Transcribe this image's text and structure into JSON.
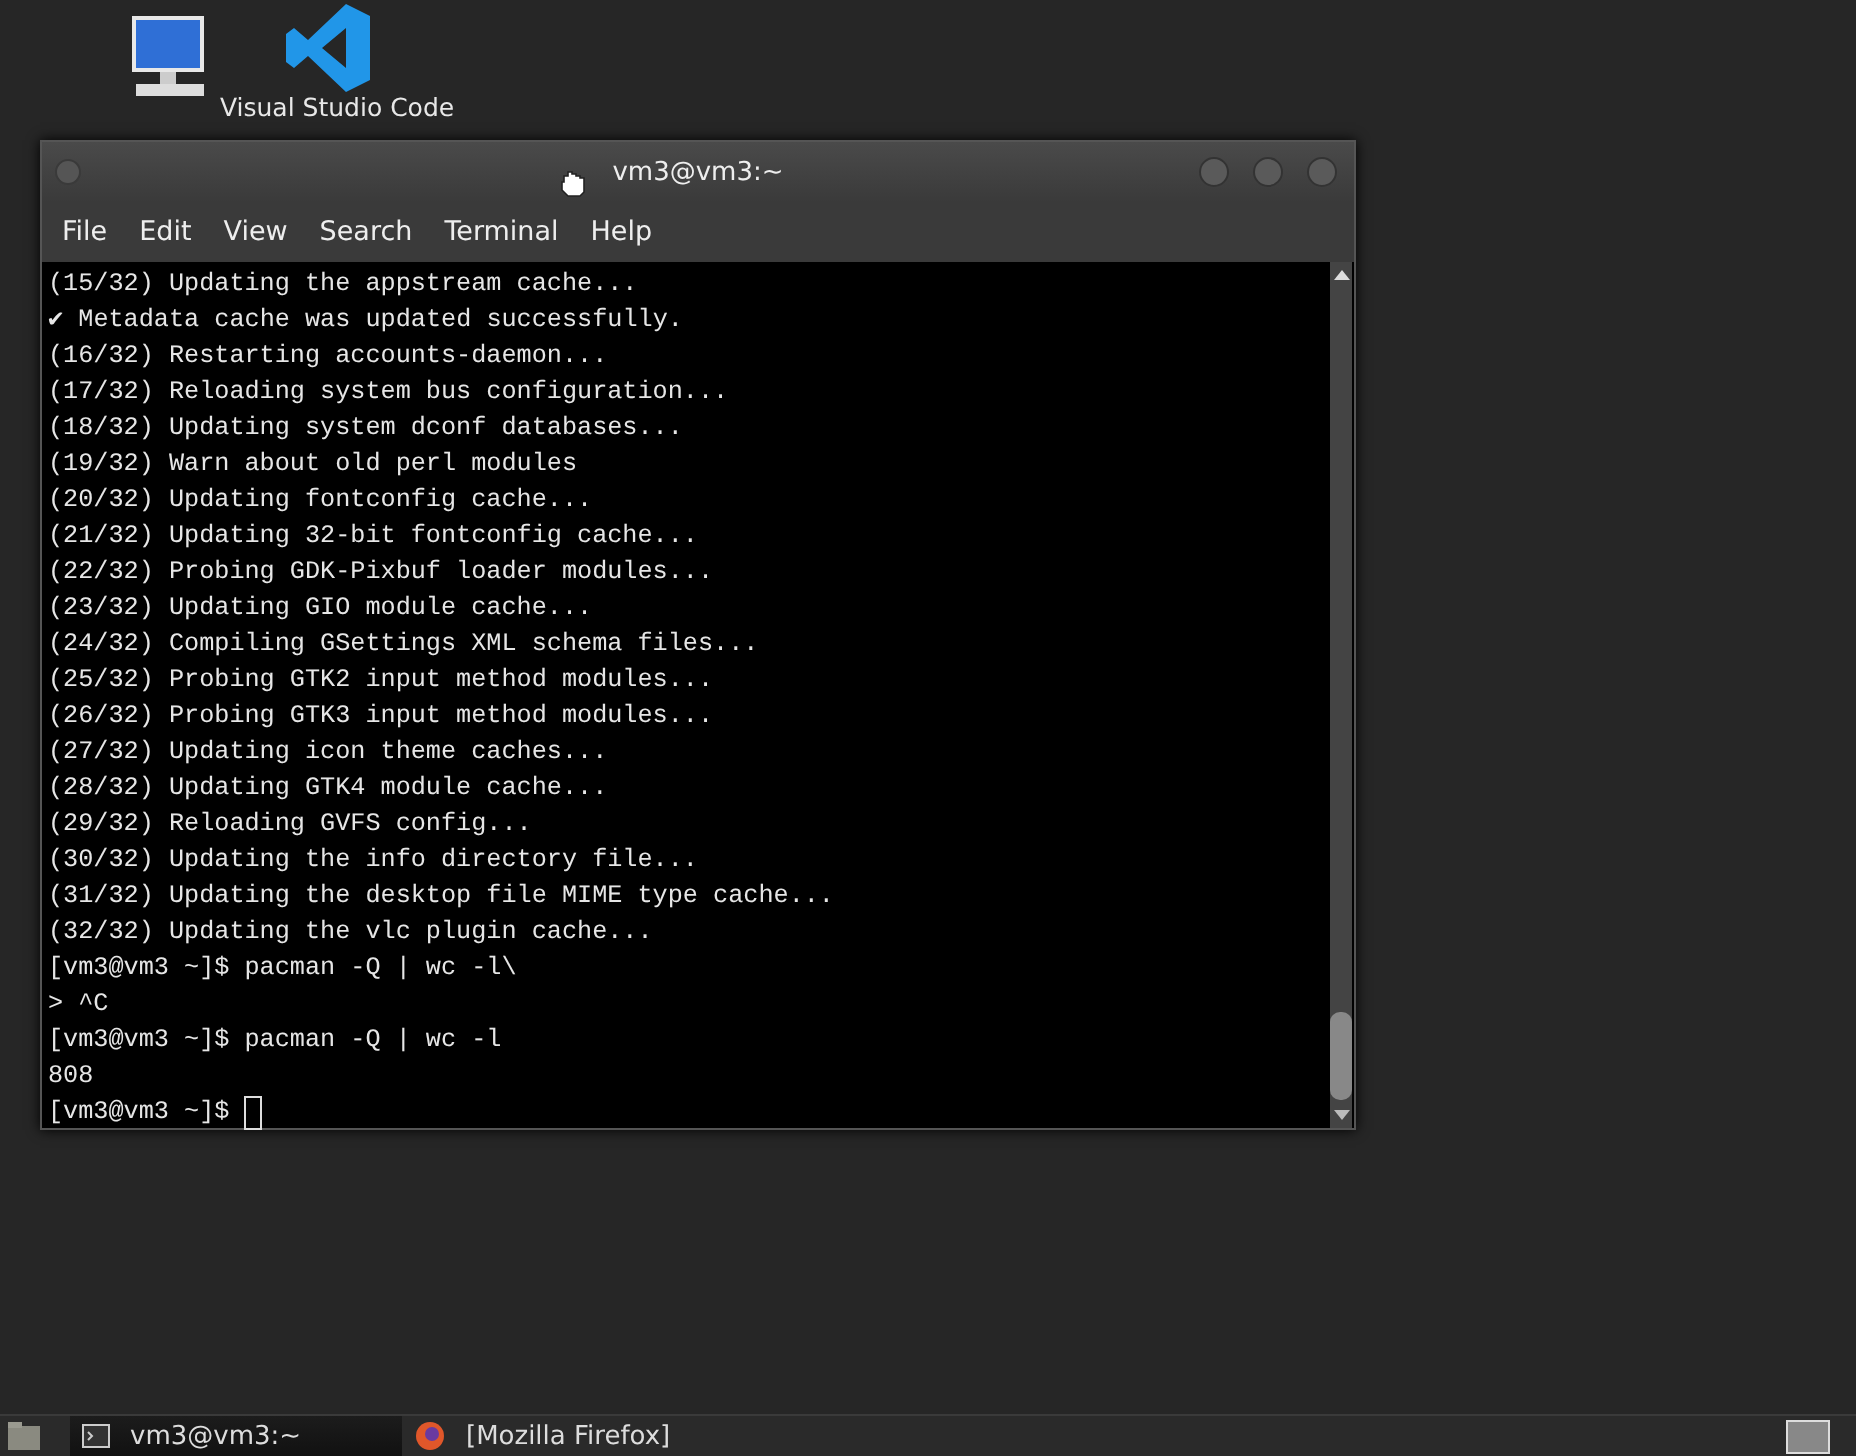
{
  "desktop_icons": [
    {
      "kind": "computer"
    },
    {
      "label": "Visual Studio Code",
      "kind": "code"
    }
  ],
  "window": {
    "title": "vm3@vm3:~"
  },
  "menu": [
    "File",
    "Edit",
    "View",
    "Search",
    "Terminal",
    "Help"
  ],
  "terminal": {
    "lines": [
      "(15/32) Updating the appstream cache...",
      "✔ Metadata cache was updated successfully.",
      "(16/32) Restarting accounts-daemon...",
      "(17/32) Reloading system bus configuration...",
      "(18/32) Updating system dconf databases...",
      "(19/32) Warn about old perl modules",
      "(20/32) Updating fontconfig cache...",
      "(21/32) Updating 32-bit fontconfig cache...",
      "(22/32) Probing GDK-Pixbuf loader modules...",
      "(23/32) Updating GIO module cache...",
      "(24/32) Compiling GSettings XML schema files...",
      "(25/32) Probing GTK2 input method modules...",
      "(26/32) Probing GTK3 input method modules...",
      "(27/32) Updating icon theme caches...",
      "(28/32) Updating GTK4 module cache...",
      "(29/32) Reloading GVFS config...",
      "(30/32) Updating the info directory file...",
      "(31/32) Updating the desktop file MIME type cache...",
      "(32/32) Updating the vlc plugin cache...",
      "[vm3@vm3 ~]$ pacman -Q | wc -l\\",
      "> ^C",
      "[vm3@vm3 ~]$ pacman -Q | wc -l",
      "808"
    ],
    "prompt": "[vm3@vm3 ~]$"
  },
  "taskbar": {
    "tasks": [
      {
        "label": "vm3@vm3:~",
        "kind": "terminal",
        "selected": true
      },
      {
        "label": "[Mozilla Firefox]",
        "kind": "firefox",
        "selected": false
      }
    ]
  }
}
